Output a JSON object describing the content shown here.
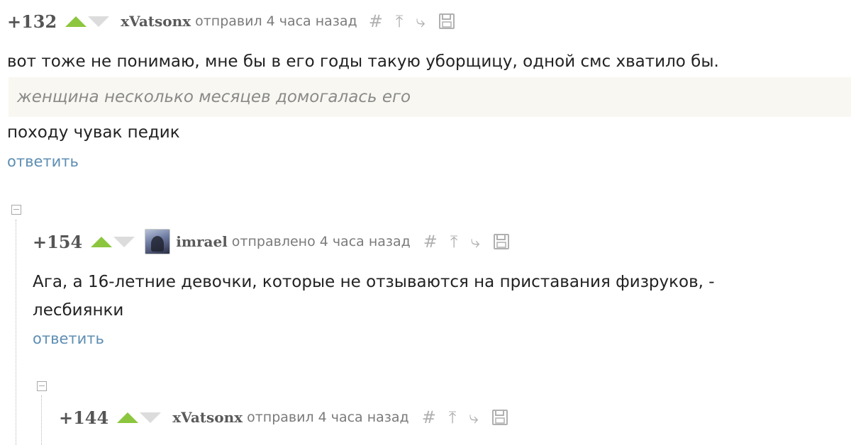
{
  "comments": [
    {
      "rating": "+132",
      "author": "xVatsonx",
      "verb": "отправил",
      "time": "4 часа назад",
      "text_before": "вот тоже не понимаю, мне бы в его годы такую уборщицу, одной смс хватило бы.",
      "quote": "женщина несколько месяцев домогалась его",
      "text_after": "походу чувак педик",
      "reply_label": "ответить"
    },
    {
      "rating": "+154",
      "author": "imrael",
      "verb": "отправлено",
      "time": "4 часа назад",
      "text": "Ага, а 16-летние девочки, которые не отзываются на приставания физруков, - лесбиянки",
      "reply_label": "ответить"
    },
    {
      "rating": "+144",
      "author": "xVatsonx",
      "verb": "отправил",
      "time": "4 часа назад"
    }
  ],
  "icons": {
    "link": "#",
    "parent": "⤒",
    "branch": "⤷",
    "save": "save-icon"
  },
  "colors": {
    "vote_up": "#8cc63f",
    "vote_down": "#dcdcdc",
    "reply_link": "#5d8eb3",
    "quote_bg": "#f8f7f1"
  }
}
